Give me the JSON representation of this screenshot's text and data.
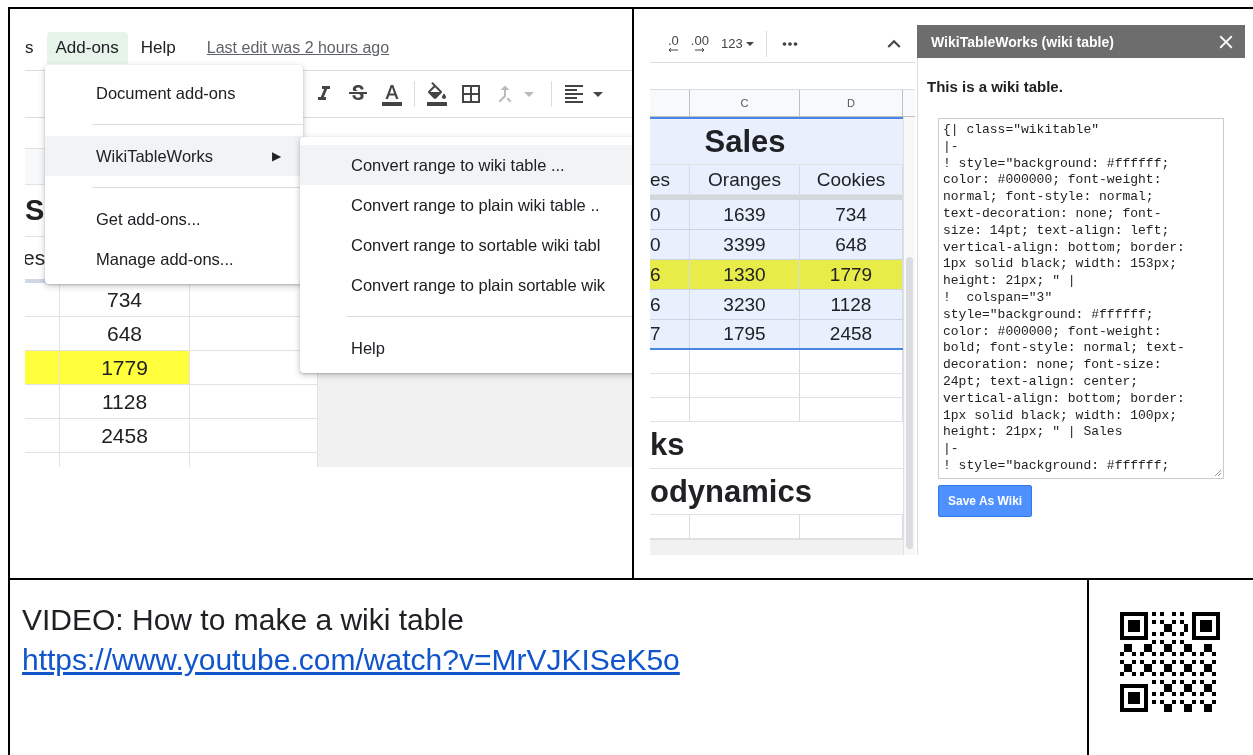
{
  "left_screenshot": {
    "menu_bar": [
      {
        "label": "s",
        "selected": false
      },
      {
        "label": "Add-ons",
        "selected": true
      },
      {
        "label": "Help",
        "selected": false
      }
    ],
    "last_edit": "Last edit was 2 hours ago",
    "sheet": {
      "title_fragment": "S",
      "header_fragment": "es",
      "rows": [
        {
          "value": "734",
          "highlighted": false
        },
        {
          "value": "648",
          "highlighted": false
        },
        {
          "value": "1779",
          "highlighted": true
        },
        {
          "value": "1128",
          "highlighted": false
        },
        {
          "value": "2458",
          "highlighted": false
        }
      ]
    },
    "addons_menu": [
      {
        "kind": "item",
        "label": "Document add-ons",
        "selected": false
      },
      {
        "kind": "divider"
      },
      {
        "kind": "submenu",
        "label": "WikiTableWorks",
        "arrow": "▶",
        "selected": true
      },
      {
        "kind": "divider"
      },
      {
        "kind": "item",
        "label": "Get add-ons...",
        "selected": false
      },
      {
        "kind": "item",
        "label": "Manage add-ons...",
        "selected": false
      }
    ],
    "submenu": [
      {
        "kind": "item",
        "label": "Convert range to wiki table ...",
        "selected": true
      },
      {
        "kind": "item",
        "label": "Convert range to plain wiki table ..",
        "selected": false
      },
      {
        "kind": "item",
        "label": "Convert range to sortable wiki tabl",
        "selected": false
      },
      {
        "kind": "item",
        "label": "Convert range to plain sortable wik",
        "selected": false
      },
      {
        "kind": "divider"
      },
      {
        "kind": "item",
        "label": "Help",
        "selected": false
      }
    ]
  },
  "right_screenshot": {
    "toolbar": {
      "decrease_decimal": ".0",
      "increase_decimal": ".00",
      "number_format": "123"
    },
    "columns": [
      "C",
      "D"
    ],
    "sheet": {
      "title": "Sales",
      "headers": [
        "es",
        "Oranges",
        "Cookies"
      ],
      "rows": [
        {
          "cells": [
            "0",
            "1639",
            "734"
          ],
          "highlighted": false
        },
        {
          "cells": [
            "0",
            "3399",
            "648"
          ],
          "highlighted": false
        },
        {
          "cells": [
            "6",
            "1330",
            "1779"
          ],
          "highlighted": true
        },
        {
          "cells": [
            "6",
            "3230",
            "1128"
          ],
          "highlighted": false
        },
        {
          "cells": [
            "7",
            "1795",
            "2458"
          ],
          "highlighted": false
        }
      ],
      "fragments": [
        "ks",
        "odynamics"
      ]
    },
    "sidebar": {
      "title": "WikiTableWorks (wiki table)",
      "heading": "This is a wiki table.",
      "code": "{| class=\"wikitable\"\n|-\n! style=\"background: #ffffff;\ncolor: #000000; font-weight:\nnormal; font-style: normal;\ntext-decoration: none; font-\nsize: 14pt; text-align: left;\nvertical-align: bottom; border:\n1px solid black; width: 153px;\nheight: 21px; \" |\n!  colspan=\"3\"\nstyle=\"background: #ffffff;\ncolor: #000000; font-weight:\nbold; font-style: normal; text-\ndecoration: none; font-size:\n24pt; text-align: center;\nvertical-align: bottom; border:\n1px solid black; width: 100px;\nheight: 21px; \" | Sales\n|-\n! style=\"background: #ffffff;",
      "button": "Save As Wiki"
    }
  },
  "footer": {
    "video_label": "VIDEO: How to make a wiki table",
    "link": "https://www.youtube.com/watch?v=MrVJKISeK5o"
  }
}
